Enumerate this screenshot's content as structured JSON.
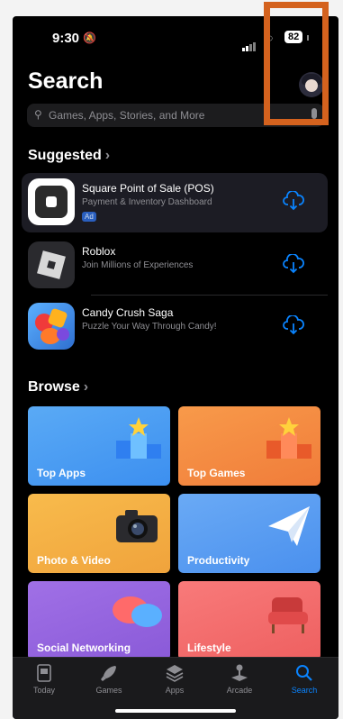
{
  "status": {
    "time": "9:30",
    "battery": "82"
  },
  "header": {
    "title": "Search"
  },
  "search": {
    "placeholder": "Games, Apps, Stories, and More"
  },
  "suggested": {
    "heading": "Suggested",
    "apps": [
      {
        "name": "Square Point of Sale (POS)",
        "subtitle": "Payment & Inventory Dashboard",
        "badge": "Ad"
      },
      {
        "name": "Roblox",
        "subtitle": "Join Millions of Experiences"
      },
      {
        "name": "Candy Crush Saga",
        "subtitle": "Puzzle Your Way Through Candy!"
      }
    ]
  },
  "browse": {
    "heading": "Browse",
    "tiles": [
      {
        "label": "Top Apps",
        "color": "#3c8ff0"
      },
      {
        "label": "Top Games",
        "color": "#f07c3a"
      },
      {
        "label": "Photo & Video",
        "color": "#f0a33c"
      },
      {
        "label": "Productivity",
        "color": "#4a90ee"
      },
      {
        "label": "Social Networking",
        "color": "#8a5ad8"
      },
      {
        "label": "Lifestyle",
        "color": "#ee6060"
      }
    ]
  },
  "tabbar": {
    "tabs": [
      {
        "label": "Today",
        "icon": "today-icon"
      },
      {
        "label": "Games",
        "icon": "rocket-icon"
      },
      {
        "label": "Apps",
        "icon": "apps-stack-icon"
      },
      {
        "label": "Arcade",
        "icon": "joystick-icon"
      },
      {
        "label": "Search",
        "icon": "search-icon",
        "active": true
      }
    ]
  },
  "colors": {
    "accent": "#0a84ff",
    "highlight": "#d4621e"
  }
}
